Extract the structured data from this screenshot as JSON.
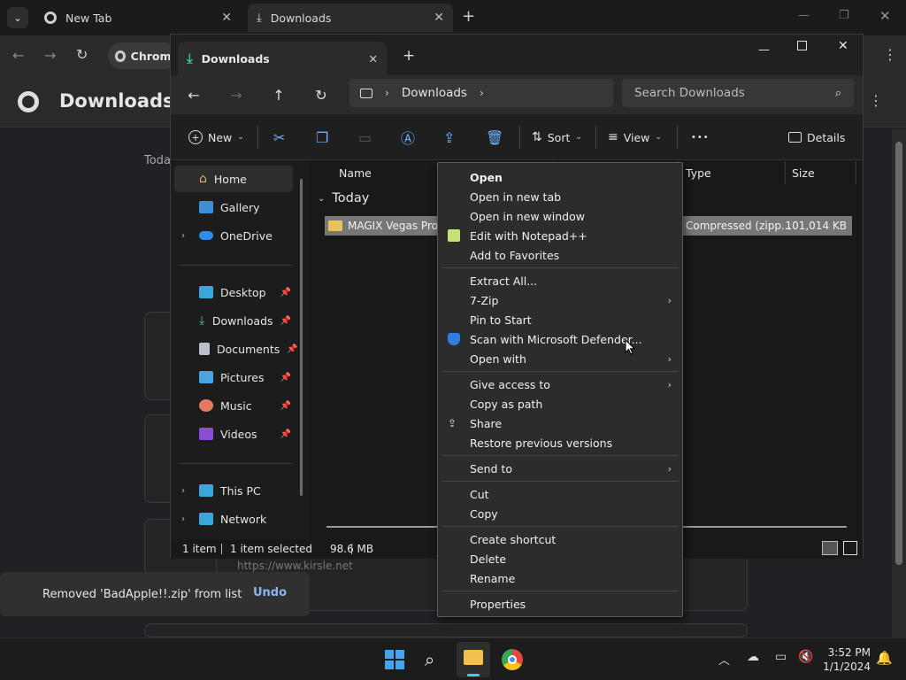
{
  "chrome": {
    "tabs": [
      {
        "label": "New Tab",
        "close": "✕"
      },
      {
        "label": "Downloads",
        "close": "✕"
      }
    ],
    "new_tab": "+",
    "profile_chip": "Chrome",
    "page_title": "Downloads",
    "date_header": "Toda",
    "url_text": "https://www.kirsle.net"
  },
  "explorer": {
    "tab_title": "Downloads",
    "tab_close": "✕",
    "tab_new": "+",
    "breadcrumb": "Downloads",
    "search_placeholder": "Search Downloads",
    "commands": {
      "new": "New",
      "sort": "Sort",
      "view": "View",
      "more": "•••",
      "details": "Details"
    },
    "sidebar": {
      "home": "Home",
      "gallery": "Gallery",
      "onedrive": "OneDrive",
      "quick": [
        "Desktop",
        "Downloads",
        "Documents",
        "Pictures",
        "Music",
        "Videos"
      ],
      "this_pc": "This PC",
      "network": "Network"
    },
    "columns": {
      "name": "Name",
      "type": "Type",
      "size": "Size"
    },
    "group": "Today",
    "file": {
      "name": "MAGIX Vegas Pro 14",
      "type": "Compressed (zipp...",
      "size": "101,014 KB"
    },
    "status": {
      "count": "1 item",
      "selected": "1 item selected",
      "size": "98.6 MB"
    }
  },
  "context_menu": {
    "group1": [
      "Open",
      "Open in new tab",
      "Open in new window",
      "Edit with Notepad++",
      "Add to Favorites"
    ],
    "group2": [
      "Extract All...",
      "7-Zip",
      "Pin to Start",
      "Scan with Microsoft Defender...",
      "Open with"
    ],
    "group3": [
      "Give access to",
      "Copy as path",
      "Share",
      "Restore previous versions"
    ],
    "group4": [
      "Send to"
    ],
    "group5": [
      "Cut",
      "Copy"
    ],
    "group6": [
      "Create shortcut",
      "Delete",
      "Rename"
    ],
    "group7": [
      "Properties"
    ]
  },
  "toast": {
    "message": "Removed 'BadApple!!.zip' from list",
    "undo": "Undo"
  },
  "taskbar": {
    "time": "3:52 PM",
    "date": "1/1/2024"
  }
}
